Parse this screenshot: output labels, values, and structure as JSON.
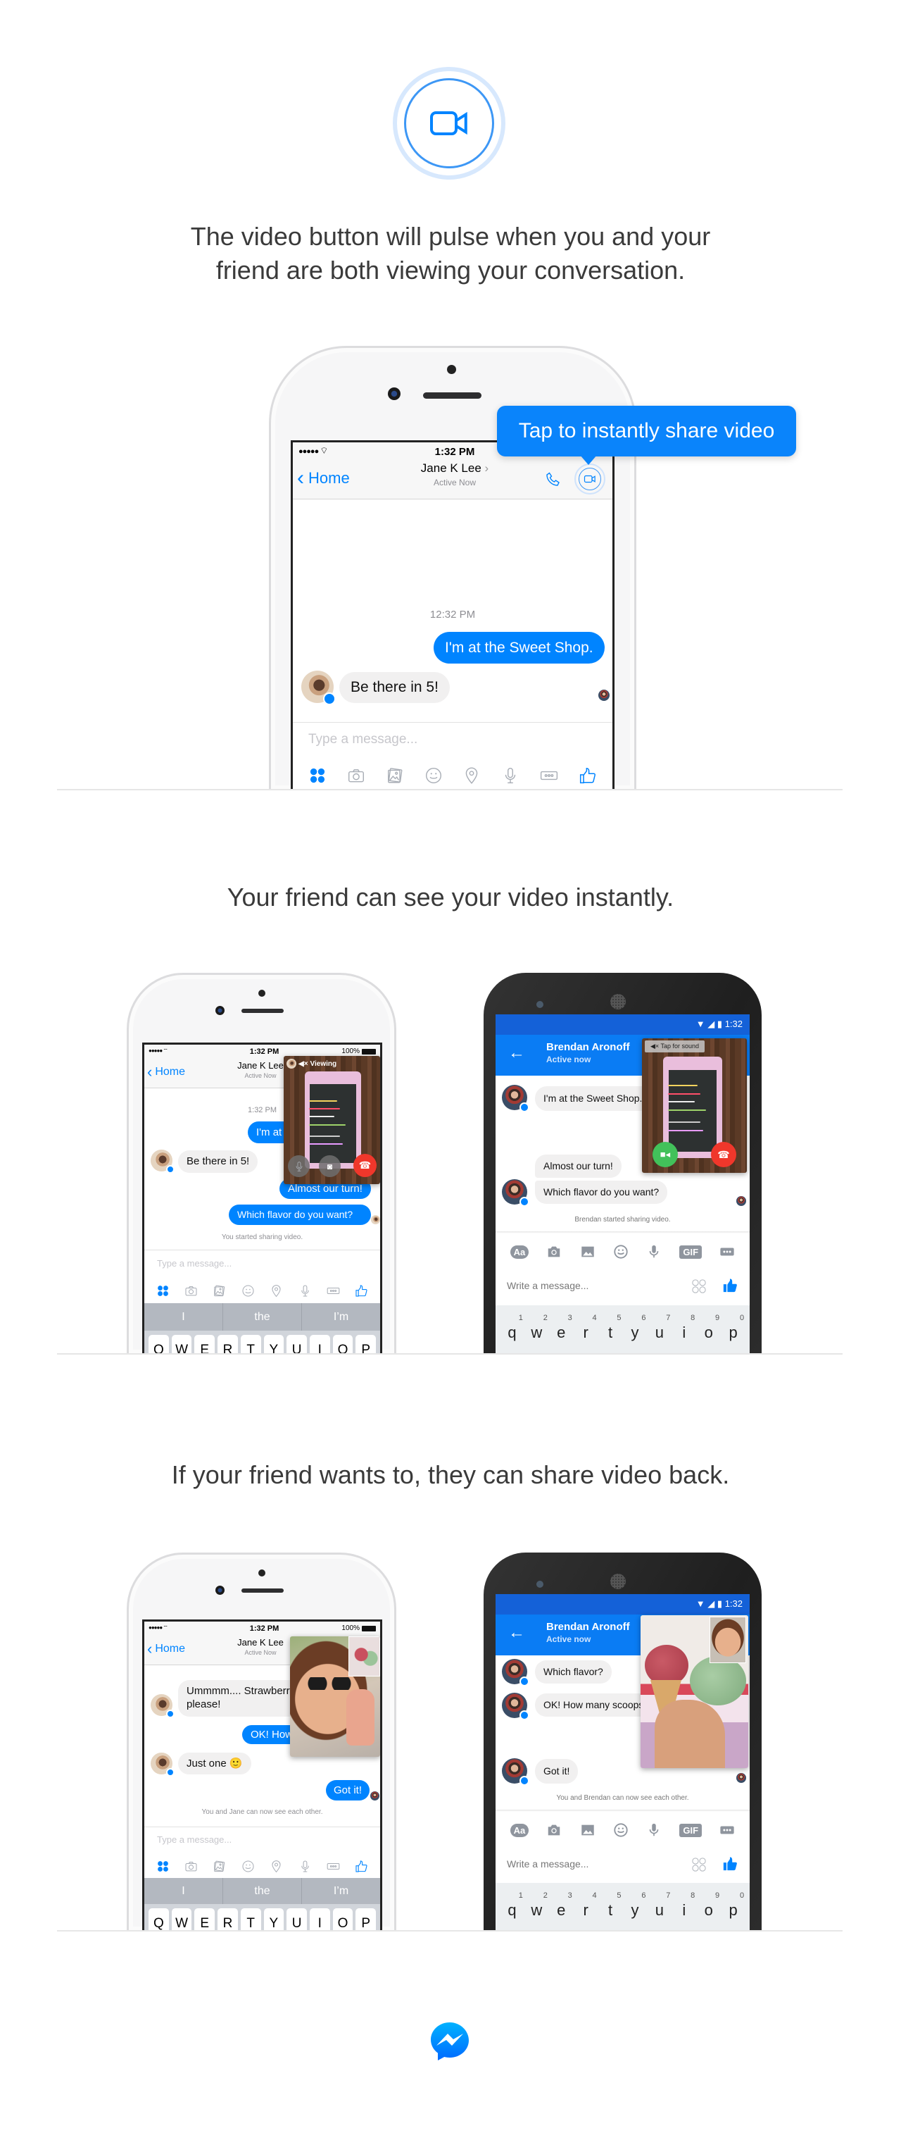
{
  "header": {
    "icon": "video-camera-icon",
    "accent": "#0084ff"
  },
  "sections": [
    {
      "caption_lines": [
        "The video button will pulse when you and your",
        "friend are both viewing your conversation."
      ]
    },
    {
      "caption": "Your friend can see your video instantly."
    },
    {
      "caption": "If your friend wants to, they can share video back."
    }
  ],
  "ios_toolbar_icons": [
    "apps-icon",
    "camera-icon",
    "photo-icon",
    "emoji-icon",
    "location-icon",
    "microphone-icon",
    "more-icon",
    "like-icon"
  ],
  "android_toolbar_icons": [
    "text-format-icon",
    "camera-icon",
    "image-icon",
    "emoji-icon",
    "microphone-icon",
    "gif-icon",
    "more-icon"
  ],
  "android_toolbar_labels": {
    "text": "Aa",
    "gif": "GIF"
  },
  "phone1": {
    "status_time": "1:32 PM",
    "back_label": "Home",
    "contact_name": "Jane K Lee",
    "contact_status": "Active Now",
    "tooltip": "Tap to instantly share video",
    "timestamp": "12:32 PM",
    "messages": [
      {
        "from": "me",
        "text": "I'm at the Sweet Shop."
      },
      {
        "from": "friend",
        "text": "Be there in 5!"
      }
    ],
    "placeholder": "Type a message..."
  },
  "phone2_ios": {
    "status_time": "1:32 PM",
    "battery": "100%",
    "back_label": "Home",
    "contact_name": "Jane K Lee",
    "contact_status": "Active Now",
    "video_label": "Viewing",
    "timestamp": "1:32 PM",
    "messages": [
      {
        "from": "me",
        "text": "I'm at the Sweet Shop."
      },
      {
        "from": "friend",
        "text": "Be there in 5!"
      },
      {
        "from": "me",
        "text": "Almost our turn!"
      },
      {
        "from": "me",
        "text": "Which flavor do you want?"
      }
    ],
    "system_message": "You started sharing video.",
    "placeholder": "Type a message...",
    "suggestions": [
      "I",
      "the",
      "I’m"
    ],
    "keys": [
      "Q",
      "W",
      "E",
      "R",
      "T",
      "Y",
      "U",
      "I",
      "O",
      "P"
    ]
  },
  "phone2_android": {
    "status_time": "1:32",
    "contact_name": "Brendan Aronoff",
    "contact_status": "Active now",
    "video_label": "Tap for sound",
    "messages": [
      {
        "from": "friend",
        "text": "I'm at the Sweet Shop."
      },
      {
        "from": "friend",
        "text": "Almost our turn!"
      },
      {
        "from": "friend",
        "text": "Which flavor do you want?"
      }
    ],
    "system_message": "Brendan started sharing video.",
    "placeholder": "Write a message...",
    "keys": [
      "q",
      "w",
      "e",
      "r",
      "t",
      "y",
      "u",
      "i",
      "o",
      "p"
    ],
    "key_hints": [
      "1",
      "2",
      "3",
      "4",
      "5",
      "6",
      "7",
      "8",
      "9",
      "0"
    ]
  },
  "phone3_ios": {
    "status_time": "1:32 PM",
    "battery": "100%",
    "back_label": "Home",
    "contact_name": "Jane K Lee",
    "contact_status": "Active Now",
    "messages": [
      {
        "from": "friend",
        "text": "Ummmm.... Strawberry please!"
      },
      {
        "from": "me",
        "text": "OK! How many scoops?"
      },
      {
        "from": "friend",
        "text": "Just one 🙂"
      },
      {
        "from": "me",
        "text": "Got it!"
      }
    ],
    "system_message": "You and Jane can now see each other.",
    "placeholder": "Type a message...",
    "suggestions": [
      "I",
      "the",
      "I’m"
    ],
    "keys": [
      "Q",
      "W",
      "E",
      "R",
      "T",
      "Y",
      "U",
      "I",
      "O",
      "P"
    ]
  },
  "phone3_android": {
    "status_time": "1:32",
    "contact_name": "Brendan Aronoff",
    "contact_status": "Active now",
    "messages": [
      {
        "from": "friend",
        "text": "Which flavor?"
      },
      {
        "from": "friend",
        "text": "OK! How many scoops?"
      },
      {
        "from": "friend",
        "text": "Got it!"
      }
    ],
    "system_message": "You and Brendan can now see each other.",
    "placeholder": "Write a message...",
    "keys": [
      "q",
      "w",
      "e",
      "r",
      "t",
      "y",
      "u",
      "i",
      "o",
      "p"
    ],
    "key_hints": [
      "1",
      "2",
      "3",
      "4",
      "5",
      "6",
      "7",
      "8",
      "9",
      "0"
    ]
  },
  "footer": {
    "logo": "messenger-logo"
  }
}
